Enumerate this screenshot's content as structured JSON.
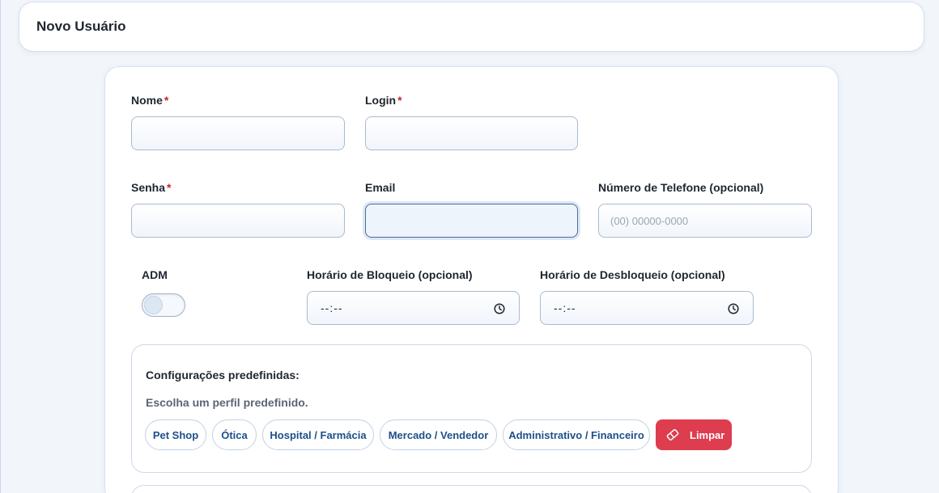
{
  "header": {
    "title": "Novo Usuário"
  },
  "form": {
    "nome_label": "Nome",
    "login_label": "Login",
    "senha_label": "Senha",
    "email_label": "Email",
    "phone_label": "Número de Telefone (opcional)",
    "phone_placeholder": "(00) 00000-0000",
    "required_mark": "*",
    "adm_label": "ADM",
    "adm_enabled": false,
    "block_label": "Horário de Bloqueio (opcional)",
    "block_value": "--:--",
    "unblock_label": "Horário de Desbloqueio (opcional)",
    "unblock_value": "--:--"
  },
  "presets": {
    "title": "Configurações predefinidas:",
    "subtitle": "Escolha um perfil predefinido.",
    "options": [
      "Pet Shop",
      "Ótica",
      "Hospital / Farmácia",
      "Mercado / Vendedor",
      "Administrativo / Financeiro"
    ],
    "clear_label": "Limpar"
  },
  "colors": {
    "accent": "#1d4f8a",
    "danger": "#dd3d4e",
    "required": "#c0262d"
  }
}
